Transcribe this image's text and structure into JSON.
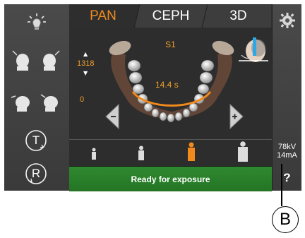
{
  "tabs": [
    {
      "label": "PAN",
      "active": true
    },
    {
      "label": "CEPH",
      "active": false
    },
    {
      "label": "3D",
      "active": false
    }
  ],
  "program_label": "S1",
  "counter_top": "1318",
  "counter_bottom": "0",
  "exposure_time": "14.4 s",
  "status": "Ready for exposure",
  "exposure": {
    "kv": "78kV",
    "ma": "14mA"
  },
  "help_label": "?",
  "left_buttons": {
    "t_label": "T",
    "r_label": "R"
  },
  "callout_label": "B",
  "colors": {
    "accent": "#f08a1c",
    "status_green": "#2f8a2f",
    "panel": "#444444"
  },
  "icons": [
    "light-icon",
    "settings-gear-icon",
    "head-tilt-icon",
    "head-rotate-icon",
    "minus-button-icon",
    "plus-button-icon",
    "patient-size-icon",
    "head-position-icon"
  ]
}
